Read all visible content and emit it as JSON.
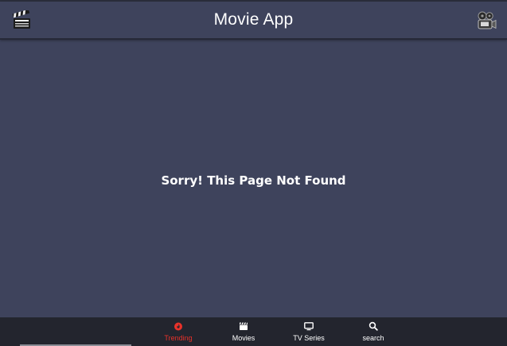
{
  "header": {
    "title": "Movie App"
  },
  "main": {
    "message": "Sorry! This Page Not Found"
  },
  "bottom_nav": {
    "items": [
      {
        "label": "Trending",
        "icon": "fire-icon",
        "active": true
      },
      {
        "label": "Movies",
        "icon": "clapperboard-icon",
        "active": false
      },
      {
        "label": "TV Series",
        "icon": "tv-icon",
        "active": false
      },
      {
        "label": "search",
        "icon": "search-icon",
        "active": false
      }
    ]
  },
  "colors": {
    "background": "#3e435c",
    "nav_background": "#23252e",
    "active": "#e8322a",
    "text": "#ffffff"
  }
}
